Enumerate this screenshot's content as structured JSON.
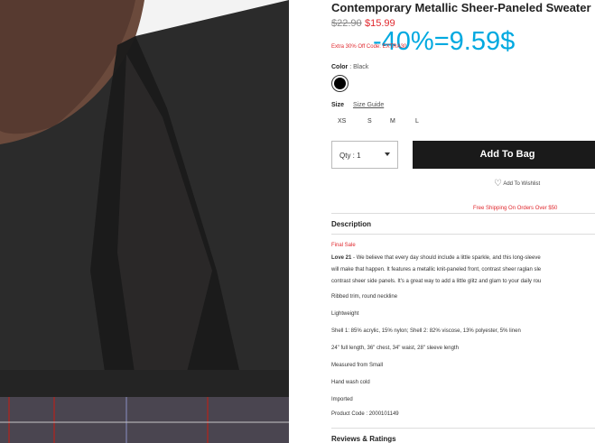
{
  "product": {
    "title": "Contemporary Metallic Sheer-Paneled Sweater",
    "price_old": "$22.90",
    "price_new": "$15.99",
    "promo_text": "Extra 30% Off Code: EXTRA30"
  },
  "overlay_text": "-40%=9.59$",
  "color": {
    "label": "Color",
    "value": ": Black",
    "swatch": "#000000"
  },
  "size": {
    "label": "Size",
    "guide_label": "Size Guide",
    "options": [
      "XS",
      "S",
      "M",
      "L"
    ]
  },
  "qty_label": "Qty : 1",
  "add_to_bag": "Add To Bag",
  "wishlist": "Add To Wishlist",
  "free_shipping": "Free Shipping On Orders Over $50",
  "description": {
    "heading": "Description",
    "final_sale": "Final Sale",
    "brand": "Love 21",
    "lines": [
      " - We believe that every day should include a little sparkle, and this long-sleeve",
      "will make that happen. It features a metallic knit-paneled front, contrast sheer raglan sle",
      "contrast sheer side panels. It's a great way to add a little glitz and glam to your daily rou"
    ],
    "details": [
      "Ribbed trim, round neckline",
      "Lightweight",
      "Shell 1: 85% acrylic, 15% nylon; Shell 2: 82% viscose, 13% polyester, 5% linen",
      "24\" full length, 36\" chest, 34\" waist, 28\" sleeve length",
      "Measured from Small",
      "Hand wash cold",
      "Imported"
    ],
    "product_code": "Product Code : 2000101149"
  },
  "reviews_heading": "Reviews & Ratings"
}
